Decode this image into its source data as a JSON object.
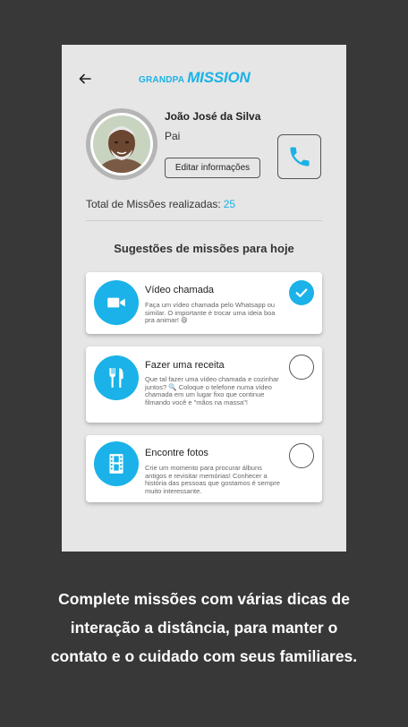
{
  "app": {
    "logo_small": "GRANDPA",
    "logo_big": "MISSION"
  },
  "profile": {
    "name": "João José da Silva",
    "relation": "Pai",
    "edit_label": "Editar informações"
  },
  "stats": {
    "label": "Total de Missões realizadas:",
    "count": "25"
  },
  "missions": {
    "title": "Sugestões de missões para hoje",
    "items": [
      {
        "title": "Vídeo chamada",
        "desc": "Faça um vídeo chamada pelo Whatsapp ou similar. O importante é trocar uma ideia boa pra animar! 😄",
        "icon": "video-camera-icon",
        "done": true
      },
      {
        "title": "Fazer uma receita",
        "desc": "Que tal fazer uma vídeo chamada e cozinhar juntos? 🔍 Coloque o telefone numa vídeo chamada em um lugar fixo que continue filmando você e \"mãos na massa\"!",
        "icon": "fork-knife-icon",
        "done": false
      },
      {
        "title": "Encontre fotos",
        "desc": "Crie um momento para procurar álbuns antigos e revisitar memórias! Conhecer a história das pessoas que gostamos é sempre muito interessante.",
        "icon": "film-icon",
        "done": false
      }
    ]
  },
  "caption": {
    "line1": "Complete missões com várias dicas de",
    "line2": "interação a distância, para manter o",
    "line3": "contato e o cuidado com seus familiares."
  },
  "colors": {
    "accent": "#1ab2e8",
    "background": "#383838",
    "screen": "#e6e6e6"
  }
}
